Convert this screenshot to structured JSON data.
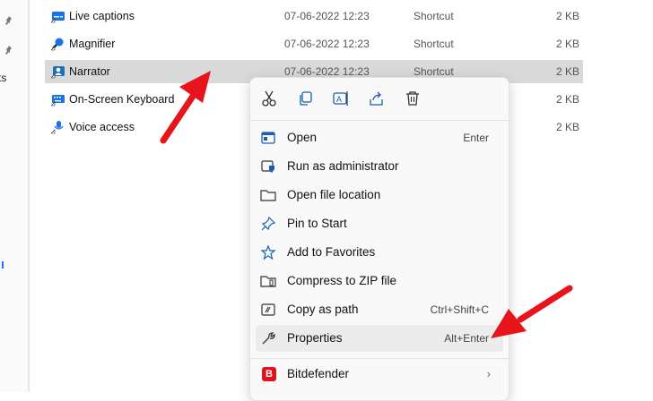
{
  "sidebar": {
    "fragment_text": "ts"
  },
  "files": [
    {
      "name": "Live captions",
      "date": "07-06-2022 12:23",
      "type": "Shortcut",
      "size": "2 KB",
      "icon": "live-captions-icon",
      "selected": false
    },
    {
      "name": "Magnifier",
      "date": "07-06-2022 12:23",
      "type": "Shortcut",
      "size": "2 KB",
      "icon": "magnifier-icon",
      "selected": false
    },
    {
      "name": "Narrator",
      "date": "07-06-2022 12:23",
      "type": "Shortcut",
      "size": "2 KB",
      "icon": "narrator-icon",
      "selected": true
    },
    {
      "name": "On-Screen Keyboard",
      "date": "",
      "type": "",
      "size": "2 KB",
      "icon": "keyboard-icon",
      "selected": false
    },
    {
      "name": "Voice access",
      "date": "",
      "type": "",
      "size": "2 KB",
      "icon": "voice-access-icon",
      "selected": false
    }
  ],
  "context_menu": {
    "quick_actions": [
      "cut-icon",
      "copy-icon",
      "rename-icon",
      "share-icon",
      "delete-icon"
    ],
    "items": [
      {
        "label": "Open",
        "shortcut": "Enter",
        "icon": "open-icon"
      },
      {
        "label": "Run as administrator",
        "shortcut": "",
        "icon": "shield-icon"
      },
      {
        "label": "Open file location",
        "shortcut": "",
        "icon": "folder-icon"
      },
      {
        "label": "Pin to Start",
        "shortcut": "",
        "icon": "pin-icon"
      },
      {
        "label": "Add to Favorites",
        "shortcut": "",
        "icon": "star-icon"
      },
      {
        "label": "Compress to ZIP file",
        "shortcut": "",
        "icon": "zip-icon"
      },
      {
        "label": "Copy as path",
        "shortcut": "Ctrl+Shift+C",
        "icon": "copy-path-icon"
      },
      {
        "label": "Properties",
        "shortcut": "Alt+Enter",
        "icon": "wrench-icon"
      }
    ],
    "bitdefender": {
      "label": "Bitdefender",
      "logo_letter": "B",
      "icon": "bitdefender-logo"
    }
  },
  "colors": {
    "accent": "#1a73e8",
    "arrow": "#e8141b",
    "selected_row": "#d9d9d9",
    "bitdefender": "#e0121b"
  }
}
